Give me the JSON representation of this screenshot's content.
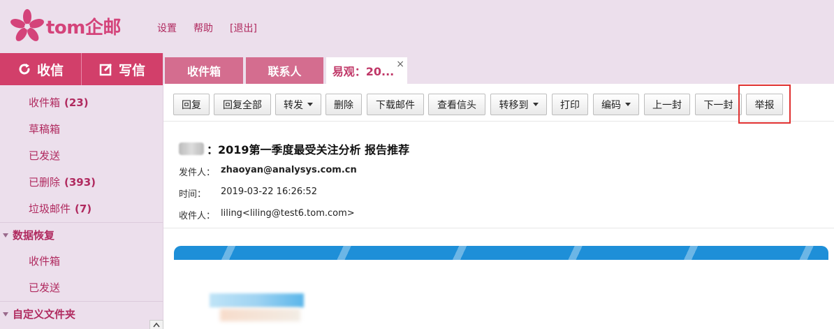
{
  "header": {
    "logo_text": "tom企邮",
    "links": [
      "设置",
      "帮助",
      "[退出]"
    ]
  },
  "sidebar": {
    "receive_label": "收信",
    "compose_label": "写信",
    "folders": [
      {
        "name": "收件箱",
        "count": "(23)"
      },
      {
        "name": "草稿箱",
        "count": ""
      },
      {
        "name": "已发送",
        "count": ""
      },
      {
        "name": "已删除",
        "count": "(393)"
      },
      {
        "name": "垃圾邮件",
        "count": "(7)"
      }
    ],
    "recovery_title": "数据恢复",
    "recovery_items": [
      "收件箱",
      "已发送"
    ],
    "custom_title": "自定义文件夹"
  },
  "tabs": [
    {
      "label": "收件箱"
    },
    {
      "label": "联系人"
    },
    {
      "label": "易观：20..."
    }
  ],
  "tab_close": "×",
  "toolbar": {
    "buttons": [
      {
        "label": "回复"
      },
      {
        "label": "回复全部"
      },
      {
        "label": "转发"
      },
      {
        "label": "删除"
      },
      {
        "label": "下载邮件"
      },
      {
        "label": "查看信头"
      },
      {
        "label": "转移到"
      },
      {
        "label": "打印"
      },
      {
        "label": "编码"
      },
      {
        "label": "上一封"
      },
      {
        "label": "下一封"
      },
      {
        "label": "举报"
      }
    ]
  },
  "mail": {
    "subject": "：2019第一季度最受关注分析 报告推荐",
    "from_label": "发件人：",
    "from_value": "zhaoyan@analysys.com.cn",
    "time_label": "时间：",
    "time_value": "2019-03-22 16:26:52",
    "to_label": "收件人：",
    "to_value": "liling<liling@test6.tom.com>"
  },
  "colors": {
    "brand": "#d23f6a",
    "link": "#b02a5f",
    "sidebar_bg": "#ecdfec",
    "highlight": "#e03030"
  }
}
